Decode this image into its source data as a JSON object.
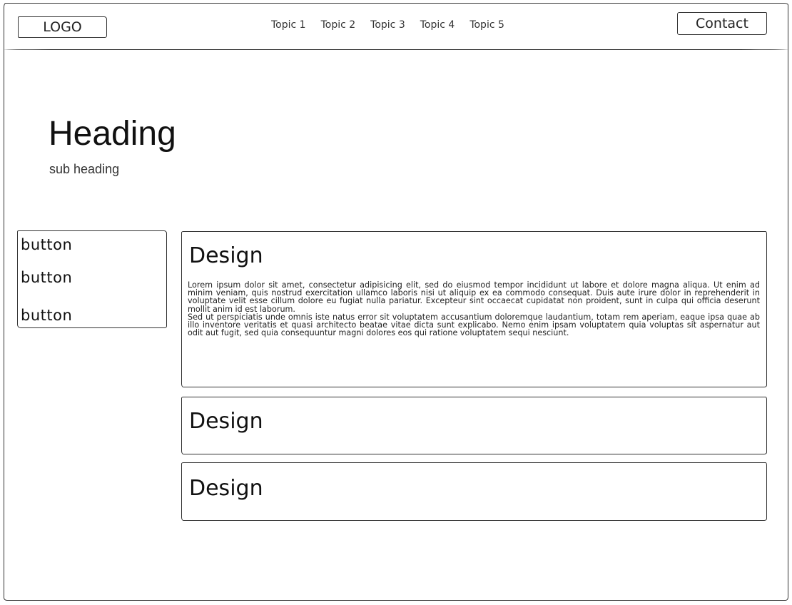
{
  "header": {
    "logo": "LOGO",
    "nav": [
      "Topic 1",
      "Topic 2",
      "Topic 3",
      "Topic 4",
      "Topic 5"
    ],
    "contact_label": "Contact"
  },
  "hero": {
    "title": "Heading",
    "subtitle": "sub heading"
  },
  "sidebar": {
    "buttons": [
      "button",
      "button",
      "button"
    ]
  },
  "cards": [
    {
      "title": "Design",
      "body": [
        "Lorem ipsum dolor sit amet, consectetur adipisicing elit, sed do eiusmod tempor incididunt ut labore et dolore magna aliqua. Ut enim ad minim veniam, quis nostrud exercitation ullamco laboris nisi ut aliquip ex ea commodo consequat. Duis aute irure dolor in reprehenderit in voluptate velit esse cillum dolore eu fugiat nulla pariatur. Excepteur sint occaecat cupidatat non proident, sunt in culpa qui officia deserunt mollit anim id est laborum.",
        "Sed ut perspiciatis unde omnis iste natus error sit voluptatem accusantium doloremque laudantium, totam rem aperiam, eaque ipsa quae ab illo inventore veritatis et quasi architecto beatae vitae dicta sunt explicabo. Nemo enim ipsam voluptatem quia voluptas sit aspernatur aut odit aut fugit, sed quia consequuntur magni dolores eos qui ratione voluptatem sequi nesciunt."
      ]
    },
    {
      "title": "Design"
    },
    {
      "title": "Design"
    }
  ]
}
